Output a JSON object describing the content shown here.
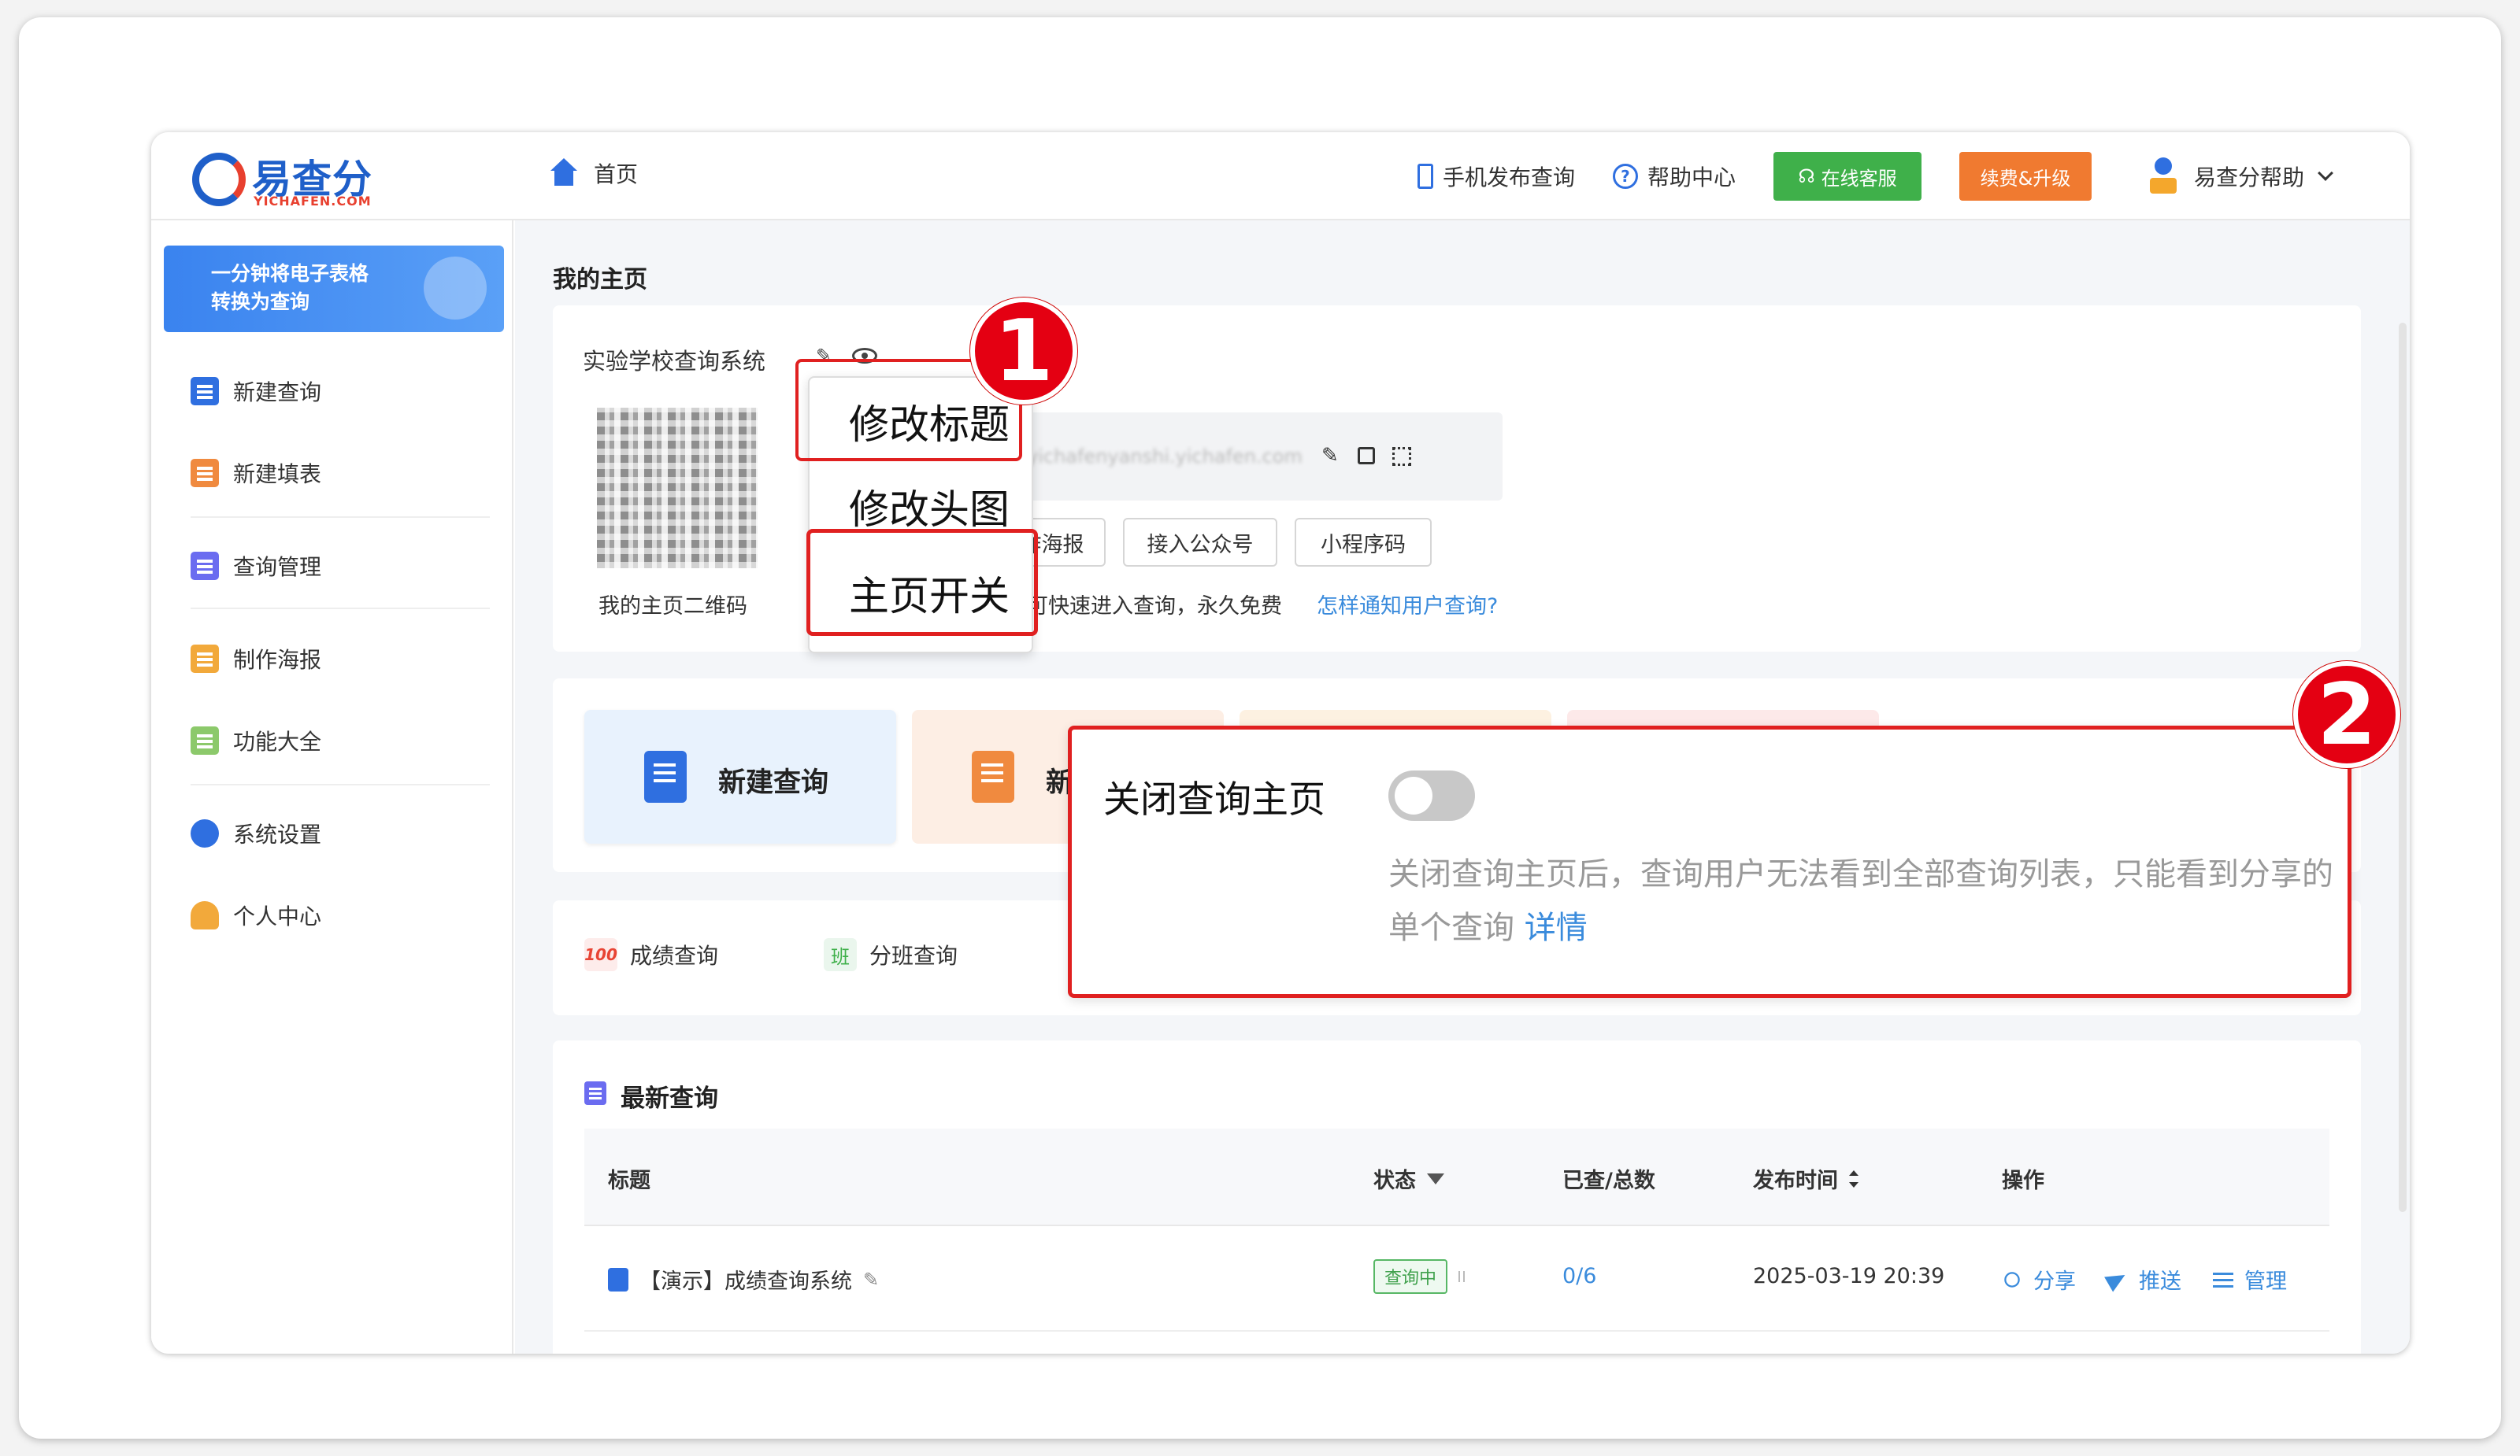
{
  "app": {
    "logo_text": "易查分",
    "logo_sub": "YICHAFEN.COM"
  },
  "topbar": {
    "home_label": "首页",
    "mobile_publish": "手机发布查询",
    "help_center": "帮助中心",
    "online_service": "在线客服",
    "renew_upgrade": "续费&升级",
    "user_name": "易查分帮助"
  },
  "sidebar": {
    "banner_line1": "一分钟将电子表格",
    "banner_line2": "转换为查询",
    "items": [
      {
        "label": "新建查询",
        "icon": "doc-search-icon"
      },
      {
        "label": "新建填表",
        "icon": "doc-edit-icon"
      },
      {
        "label": "查询管理",
        "icon": "list-icon"
      },
      {
        "label": "制作海报",
        "icon": "image-icon"
      },
      {
        "label": "功能大全",
        "icon": "grid-icon"
      },
      {
        "label": "系统设置",
        "icon": "gear-icon"
      },
      {
        "label": "个人中心",
        "icon": "person-icon"
      }
    ]
  },
  "main": {
    "page_title": "我的主页",
    "site_name": "实验学校查询系统",
    "qr_label": "我的主页二维码",
    "url_text": "yichafenyanshi.yichafen.com",
    "buttons": [
      "作海报",
      "接入公众号",
      "小程序码"
    ],
    "hint_text": "可快速进入查询，永久免费",
    "hint_link": "怎样通知用户查询?",
    "tiles": [
      {
        "label": "新建查询"
      },
      {
        "label": "新"
      }
    ],
    "templates": [
      {
        "icon_text": "100",
        "label": "成绩查询"
      },
      {
        "icon_text": "班",
        "label": "分班查询"
      }
    ]
  },
  "latest": {
    "title": "最新查询",
    "columns": [
      "标题",
      "状态",
      "已查/总数",
      "发布时间",
      "操作"
    ],
    "rows": [
      {
        "title": "【演示】成绩查询系统",
        "status": "查询中",
        "count": "0/6",
        "published": "2025-03-19 20:39",
        "actions": [
          "分享",
          "推送",
          "管理"
        ]
      }
    ]
  },
  "popup_menu": {
    "items": [
      "修改标题",
      "修改头图",
      "主页开关"
    ]
  },
  "annotations": {
    "badge1": "1",
    "badge2": "2"
  },
  "toggle_panel": {
    "title": "关闭查询主页",
    "toggle_on": false,
    "desc": "关闭查询主页后，查询用户无法看到全部查询列表，只能看到分享的单个查询",
    "link": "详情"
  },
  "colors": {
    "brand": "#1f5fc9",
    "accent_red": "#e02020",
    "service_green": "#3fb04a",
    "upgrade_orange": "#f07a30",
    "link": "#3a8bdc"
  }
}
